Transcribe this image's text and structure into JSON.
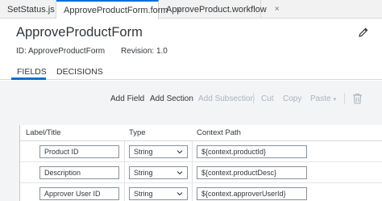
{
  "tabs": [
    {
      "label": "SetStatus.js",
      "close": "×",
      "active": false
    },
    {
      "label": "ApproveProductForm.form",
      "close": "×",
      "active": true
    },
    {
      "label": "ApproveProduct.workflow",
      "close": "×",
      "active": false
    }
  ],
  "header": {
    "title": "ApproveProductForm",
    "id_text": "ID: ApproveProductForm",
    "revision_text": "Revision: 1.0"
  },
  "subtabs": {
    "fields": "FIELDS",
    "decisions": "DECISIONS",
    "active": "fields"
  },
  "toolbar": {
    "add_field": "Add Field",
    "add_section": "Add Section",
    "add_subsection": "Add Subsection",
    "cut": "Cut",
    "copy": "Copy",
    "paste": "Paste"
  },
  "table": {
    "headers": [
      "Label/Title",
      "Type",
      "Context Path"
    ],
    "rows": [
      {
        "label": "Product ID",
        "type": "String",
        "path": "${context.productId}"
      },
      {
        "label": "Description",
        "type": "String",
        "path": "${context.productDesc}"
      },
      {
        "label": "Approver User ID",
        "type": "String",
        "path": "${context.approverUserId}"
      }
    ]
  },
  "colors": {
    "accent": "#0a6ed1",
    "disabled": "#a9b4be",
    "text": "#32363a"
  }
}
